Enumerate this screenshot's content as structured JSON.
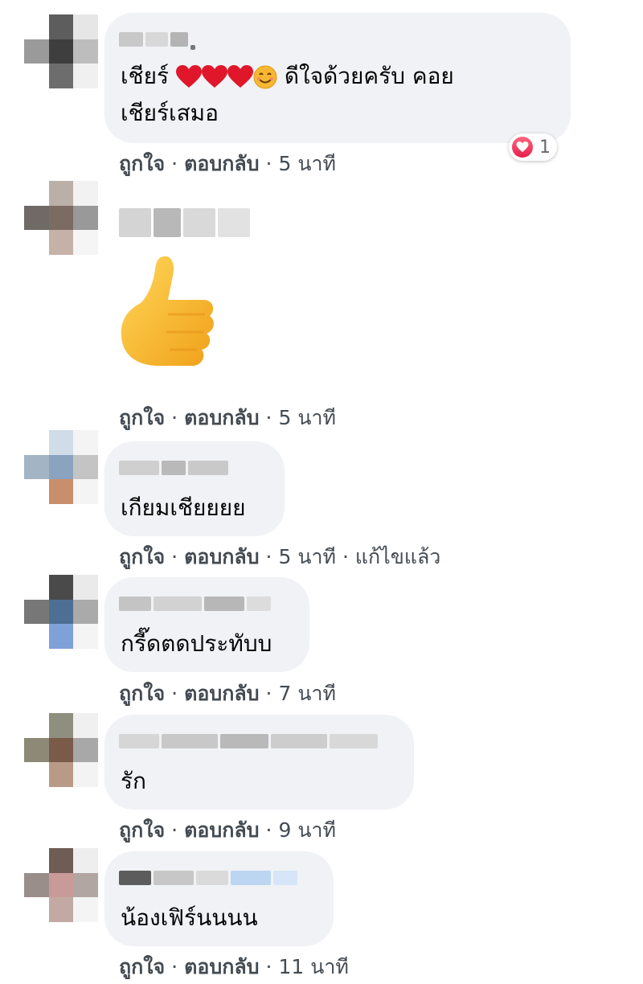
{
  "comments": [
    {
      "text_line1": "เชียร์",
      "text_line1_tail": "ดีใจด้วยครับ คอย",
      "text_line2": "เชียร์เสมอ",
      "reaction_count": "1",
      "actions": {
        "like": "ถูกใจ",
        "reply": "ตอบกลับ",
        "time": "5 นาที"
      }
    },
    {
      "sticker": "thumbs-up",
      "actions": {
        "like": "ถูกใจ",
        "reply": "ตอบกลับ",
        "time": "5 นาที"
      }
    },
    {
      "text": "เกียมเชียยยย",
      "actions": {
        "like": "ถูกใจ",
        "reply": "ตอบกลับ",
        "time": "5 นาที",
        "edited": "แก้ไขแล้ว"
      }
    },
    {
      "text": "กรี๊ดตดประทับบ",
      "actions": {
        "like": "ถูกใจ",
        "reply": "ตอบกลับ",
        "time": "7 นาที"
      }
    },
    {
      "text": "รัก",
      "actions": {
        "like": "ถูกใจ",
        "reply": "ตอบกลับ",
        "time": "9 นาที"
      }
    },
    {
      "text": "น้องเฟิร์นนนน",
      "actions": {
        "like": "ถูกใจ",
        "reply": "ตอบกลับ",
        "time": "11 นาที"
      }
    }
  ],
  "separator": "·",
  "colors": {
    "bubble": "#f0f2f5",
    "meta": "#444b52",
    "heart": "#f33e58"
  }
}
